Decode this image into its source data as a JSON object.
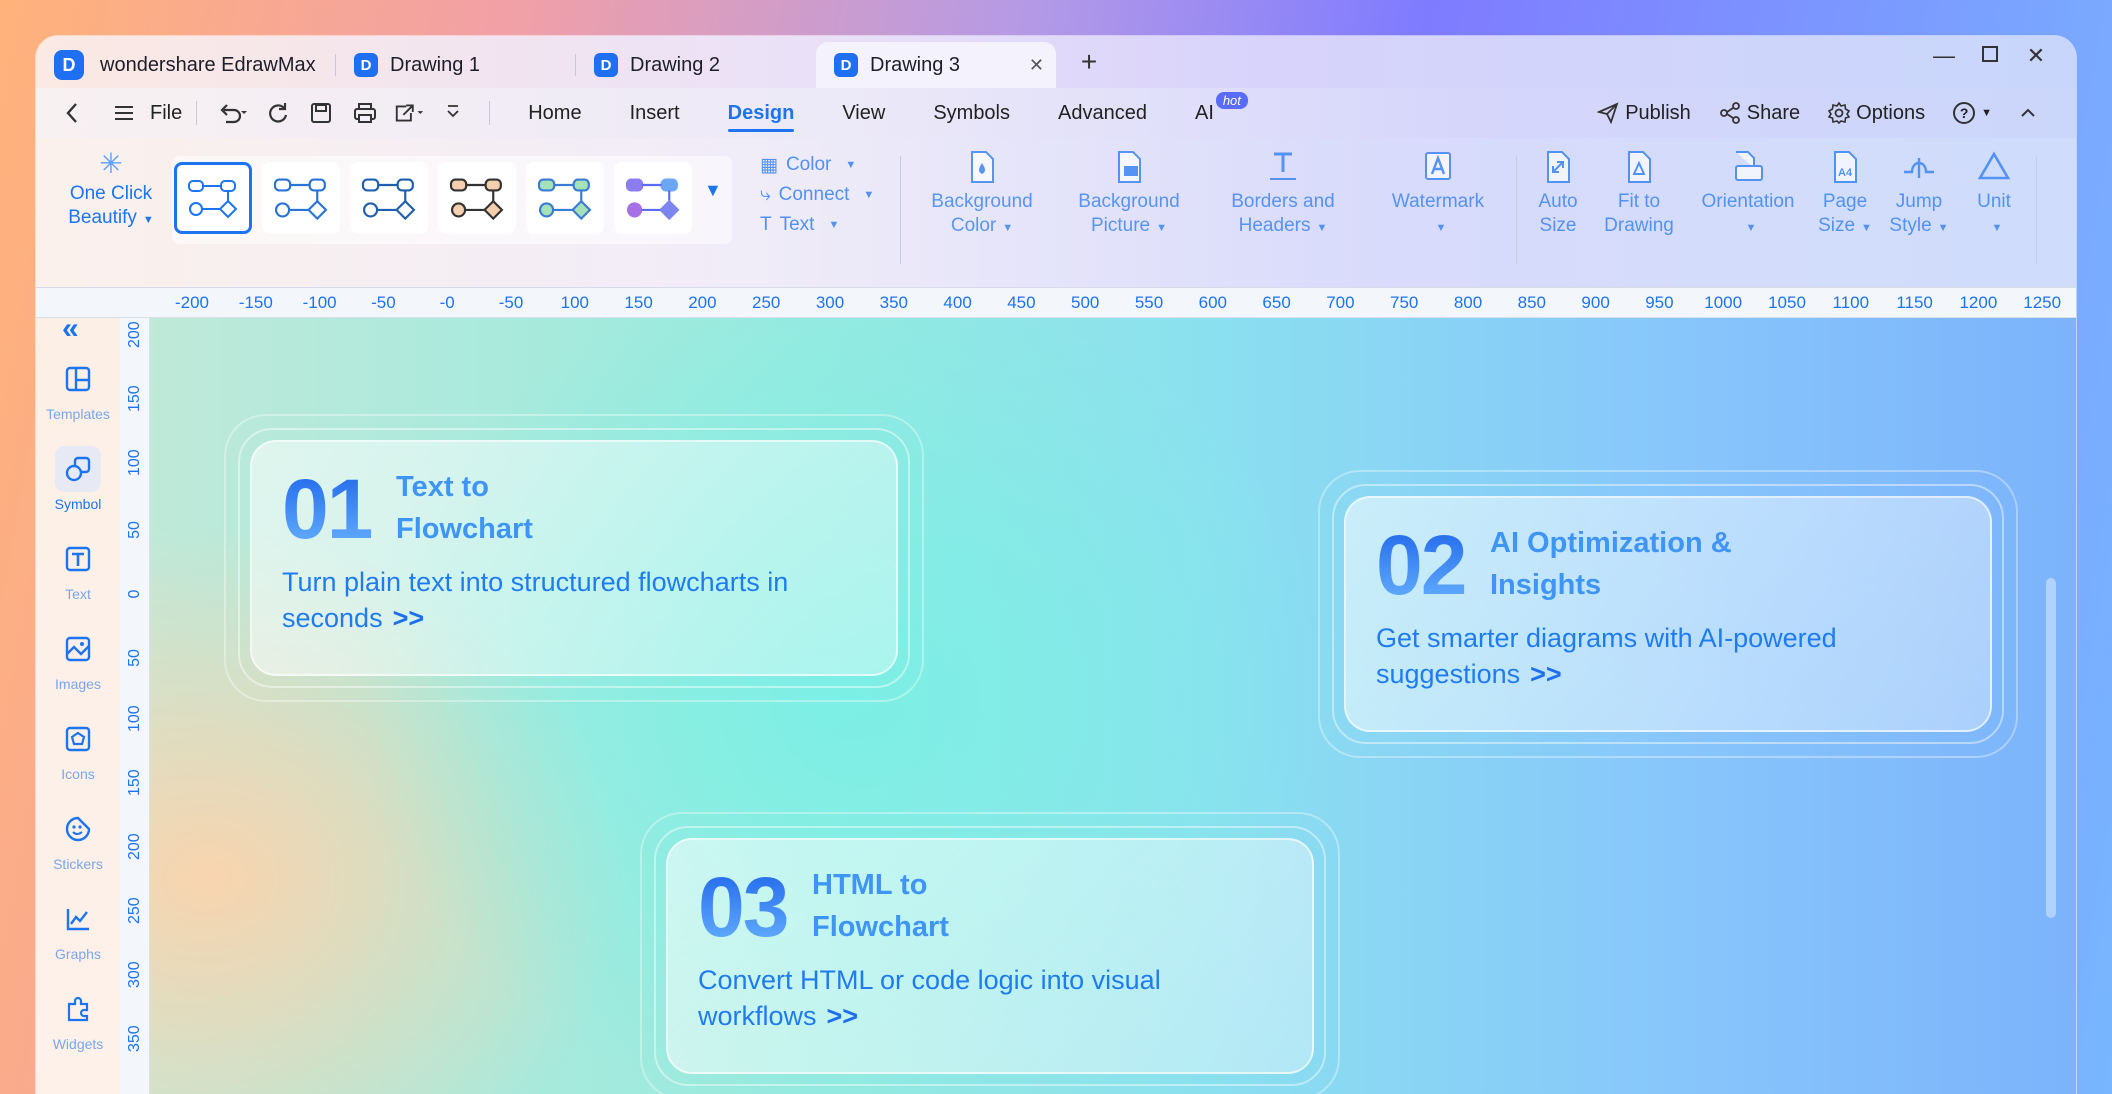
{
  "app": {
    "name": "wondershare EdrawMax",
    "tabs": [
      {
        "label": "Drawing 1"
      },
      {
        "label": "Drawing 2"
      },
      {
        "label": "Drawing 3",
        "active": true
      }
    ],
    "new_tab": "+"
  },
  "menubar": {
    "file": "File",
    "tabs": [
      "Home",
      "Insert",
      "Design",
      "View",
      "Symbols",
      "Advanced",
      "AI"
    ],
    "active_tab": "Design",
    "ai_badge": "hot",
    "publish": "Publish",
    "share": "Share",
    "options": "Options",
    "help": "?"
  },
  "ribbon": {
    "one_click_beautify": "One Click Beautify",
    "color": "Color",
    "connect": "Connect",
    "text": "Text",
    "buttons": [
      {
        "label": "Background Color",
        "icon": "background-color-icon"
      },
      {
        "label": "Background Picture",
        "icon": "background-picture-icon"
      },
      {
        "label": "Borders and Headers",
        "icon": "borders-headers-icon"
      },
      {
        "label": "Watermark",
        "icon": "watermark-icon"
      },
      {
        "label": "Auto Size",
        "icon": "auto-size-icon"
      },
      {
        "label": "Fit to Drawing",
        "icon": "fit-to-drawing-icon"
      },
      {
        "label": "Orientation",
        "icon": "orientation-icon"
      },
      {
        "label": "Page Size",
        "icon": "page-size-icon"
      },
      {
        "label": "Jump Style",
        "icon": "jump-style-icon"
      },
      {
        "label": "Unit",
        "icon": "unit-icon"
      }
    ]
  },
  "ruler": {
    "horizontal": [
      "-200",
      "-150",
      "-100",
      "-50",
      "-0",
      "-50",
      "100",
      "150",
      "200",
      "250",
      "300",
      "350",
      "400",
      "450",
      "500",
      "550",
      "600",
      "650",
      "700",
      "750",
      "800",
      "850",
      "900",
      "950",
      "1000",
      "1050",
      "1100",
      "1150",
      "1200",
      "1250"
    ],
    "vertical": [
      "200",
      "150",
      "100",
      "50",
      "0",
      "50",
      "100",
      "150",
      "200",
      "250",
      "300",
      "350"
    ]
  },
  "sidebar": {
    "items": [
      {
        "label": "Templates",
        "icon": "templates-icon"
      },
      {
        "label": "Symbol",
        "icon": "symbol-icon",
        "active": true
      },
      {
        "label": "Text",
        "icon": "text-icon"
      },
      {
        "label": "Images",
        "icon": "images-icon"
      },
      {
        "label": "Icons",
        "icon": "icons-icon"
      },
      {
        "label": "Stickers",
        "icon": "stickers-icon"
      },
      {
        "label": "Graphs",
        "icon": "graphs-icon"
      },
      {
        "label": "Widgets",
        "icon": "widgets-icon"
      }
    ]
  },
  "cards": [
    {
      "number": "01",
      "title": "Text to Flowchart",
      "desc": "Turn plain text into structured flowcharts in seconds",
      "arrow": ">>"
    },
    {
      "number": "02",
      "title": "AI Optimization & Insights",
      "desc": "Get smarter diagrams with AI-powered suggestions",
      "arrow": ">>"
    },
    {
      "number": "03",
      "title": "HTML to Flowchart",
      "desc": "Convert HTML or code logic into visual workflows",
      "arrow": ">>"
    }
  ],
  "colors": {
    "accent": "#1d74f0",
    "badge": "#5a6cf7"
  }
}
